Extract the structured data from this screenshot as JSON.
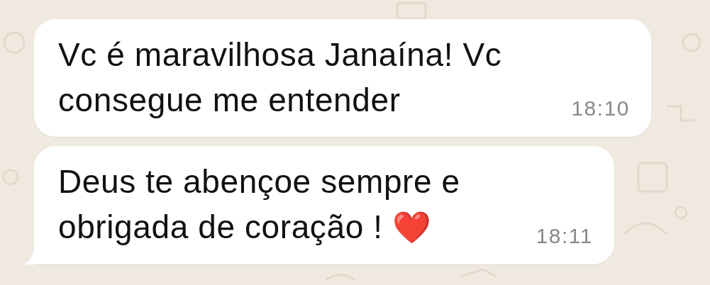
{
  "messages": [
    {
      "text": "Vc é maravilhosa Janaína! Vc consegue me entender",
      "time": "18:10",
      "tail": false
    },
    {
      "text": "Deus te abençoe sempre e obrigada de coração !",
      "emoji": "❤️",
      "time": "18:11",
      "tail": true
    }
  ]
}
